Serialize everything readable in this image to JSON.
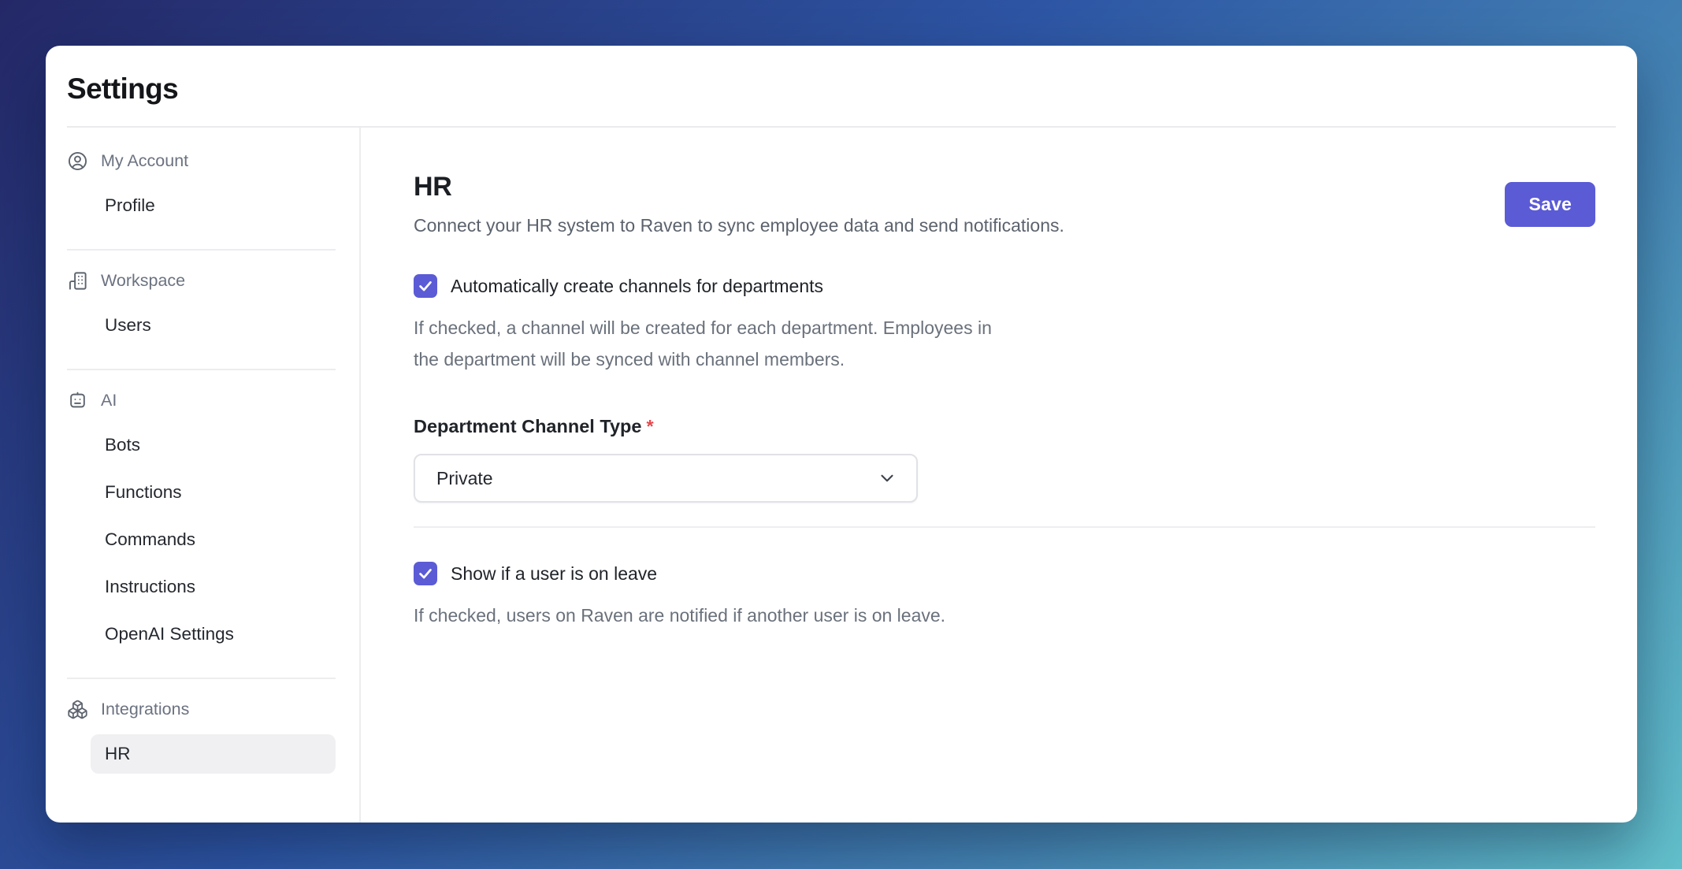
{
  "page_title": "Settings",
  "sidebar": {
    "sections": [
      {
        "label": "My Account",
        "icon": "user-circle-icon",
        "items": [
          {
            "label": "Profile",
            "active": false
          }
        ]
      },
      {
        "label": "Workspace",
        "icon": "building-icon",
        "items": [
          {
            "label": "Users",
            "active": false
          }
        ]
      },
      {
        "label": "AI",
        "icon": "bot-icon",
        "items": [
          {
            "label": "Bots",
            "active": false
          },
          {
            "label": "Functions",
            "active": false
          },
          {
            "label": "Commands",
            "active": false
          },
          {
            "label": "Instructions",
            "active": false
          },
          {
            "label": "OpenAI Settings",
            "active": false
          }
        ]
      },
      {
        "label": "Integrations",
        "icon": "boxes-icon",
        "items": [
          {
            "label": "HR",
            "active": true
          }
        ]
      }
    ]
  },
  "main": {
    "title": "HR",
    "description": "Connect your HR system to Raven to sync employee data and send notifications.",
    "save_button": "Save",
    "checkbox_auto": {
      "label": "Automatically create channels for departments",
      "checked": true,
      "help_line1": "If checked, a channel will be created for each department. Employees in",
      "help_line2": "the department will be synced with channel members."
    },
    "select_field": {
      "label": "Department Channel Type",
      "required_mark": "*",
      "value": "Private"
    },
    "checkbox_leave": {
      "label": "Show if a user is on leave",
      "checked": true,
      "help_line1": "If checked, users on Raven are notified if another user is on leave."
    }
  },
  "colors": {
    "accent": "#5b5bd6",
    "required_asterisk": "#e5484d",
    "background_gradient_start": "#242867",
    "background_gradient_end": "#62c0cb",
    "active_item_background": "#f0f0f2"
  }
}
